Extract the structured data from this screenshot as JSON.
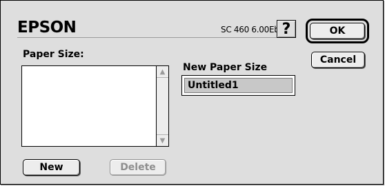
{
  "header": {
    "brand": "EPSON",
    "version": "SC 460 6.00Eb",
    "help_label": "?"
  },
  "buttons": {
    "ok": "OK",
    "cancel": "Cancel",
    "new": "New",
    "delete": "Delete"
  },
  "paper_size": {
    "label": "Paper Size:",
    "items": []
  },
  "new_paper_size": {
    "label": "New Paper Size",
    "value": "Untitled1"
  },
  "icons": {
    "scroll_up": "triangle-up",
    "scroll_down": "triangle-down"
  },
  "colors": {
    "dialog_background": "#dedede",
    "disabled_text": "#8e8e8e",
    "field_highlight": "#c8c8c8"
  }
}
